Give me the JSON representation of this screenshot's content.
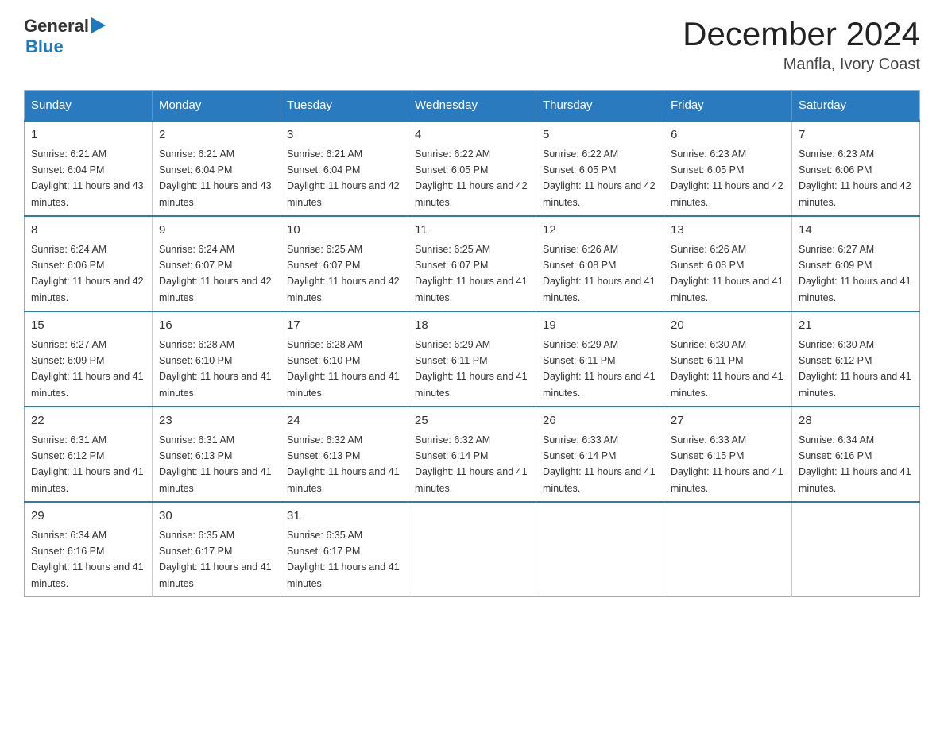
{
  "header": {
    "logo": {
      "general": "General",
      "blue": "Blue"
    },
    "title": "December 2024",
    "location": "Manfla, Ivory Coast"
  },
  "calendar": {
    "days_of_week": [
      "Sunday",
      "Monday",
      "Tuesday",
      "Wednesday",
      "Thursday",
      "Friday",
      "Saturday"
    ],
    "weeks": [
      [
        {
          "day": "1",
          "sunrise": "6:21 AM",
          "sunset": "6:04 PM",
          "daylight": "11 hours and 43 minutes."
        },
        {
          "day": "2",
          "sunrise": "6:21 AM",
          "sunset": "6:04 PM",
          "daylight": "11 hours and 43 minutes."
        },
        {
          "day": "3",
          "sunrise": "6:21 AM",
          "sunset": "6:04 PM",
          "daylight": "11 hours and 42 minutes."
        },
        {
          "day": "4",
          "sunrise": "6:22 AM",
          "sunset": "6:05 PM",
          "daylight": "11 hours and 42 minutes."
        },
        {
          "day": "5",
          "sunrise": "6:22 AM",
          "sunset": "6:05 PM",
          "daylight": "11 hours and 42 minutes."
        },
        {
          "day": "6",
          "sunrise": "6:23 AM",
          "sunset": "6:05 PM",
          "daylight": "11 hours and 42 minutes."
        },
        {
          "day": "7",
          "sunrise": "6:23 AM",
          "sunset": "6:06 PM",
          "daylight": "11 hours and 42 minutes."
        }
      ],
      [
        {
          "day": "8",
          "sunrise": "6:24 AM",
          "sunset": "6:06 PM",
          "daylight": "11 hours and 42 minutes."
        },
        {
          "day": "9",
          "sunrise": "6:24 AM",
          "sunset": "6:07 PM",
          "daylight": "11 hours and 42 minutes."
        },
        {
          "day": "10",
          "sunrise": "6:25 AM",
          "sunset": "6:07 PM",
          "daylight": "11 hours and 42 minutes."
        },
        {
          "day": "11",
          "sunrise": "6:25 AM",
          "sunset": "6:07 PM",
          "daylight": "11 hours and 41 minutes."
        },
        {
          "day": "12",
          "sunrise": "6:26 AM",
          "sunset": "6:08 PM",
          "daylight": "11 hours and 41 minutes."
        },
        {
          "day": "13",
          "sunrise": "6:26 AM",
          "sunset": "6:08 PM",
          "daylight": "11 hours and 41 minutes."
        },
        {
          "day": "14",
          "sunrise": "6:27 AM",
          "sunset": "6:09 PM",
          "daylight": "11 hours and 41 minutes."
        }
      ],
      [
        {
          "day": "15",
          "sunrise": "6:27 AM",
          "sunset": "6:09 PM",
          "daylight": "11 hours and 41 minutes."
        },
        {
          "day": "16",
          "sunrise": "6:28 AM",
          "sunset": "6:10 PM",
          "daylight": "11 hours and 41 minutes."
        },
        {
          "day": "17",
          "sunrise": "6:28 AM",
          "sunset": "6:10 PM",
          "daylight": "11 hours and 41 minutes."
        },
        {
          "day": "18",
          "sunrise": "6:29 AM",
          "sunset": "6:11 PM",
          "daylight": "11 hours and 41 minutes."
        },
        {
          "day": "19",
          "sunrise": "6:29 AM",
          "sunset": "6:11 PM",
          "daylight": "11 hours and 41 minutes."
        },
        {
          "day": "20",
          "sunrise": "6:30 AM",
          "sunset": "6:11 PM",
          "daylight": "11 hours and 41 minutes."
        },
        {
          "day": "21",
          "sunrise": "6:30 AM",
          "sunset": "6:12 PM",
          "daylight": "11 hours and 41 minutes."
        }
      ],
      [
        {
          "day": "22",
          "sunrise": "6:31 AM",
          "sunset": "6:12 PM",
          "daylight": "11 hours and 41 minutes."
        },
        {
          "day": "23",
          "sunrise": "6:31 AM",
          "sunset": "6:13 PM",
          "daylight": "11 hours and 41 minutes."
        },
        {
          "day": "24",
          "sunrise": "6:32 AM",
          "sunset": "6:13 PM",
          "daylight": "11 hours and 41 minutes."
        },
        {
          "day": "25",
          "sunrise": "6:32 AM",
          "sunset": "6:14 PM",
          "daylight": "11 hours and 41 minutes."
        },
        {
          "day": "26",
          "sunrise": "6:33 AM",
          "sunset": "6:14 PM",
          "daylight": "11 hours and 41 minutes."
        },
        {
          "day": "27",
          "sunrise": "6:33 AM",
          "sunset": "6:15 PM",
          "daylight": "11 hours and 41 minutes."
        },
        {
          "day": "28",
          "sunrise": "6:34 AM",
          "sunset": "6:16 PM",
          "daylight": "11 hours and 41 minutes."
        }
      ],
      [
        {
          "day": "29",
          "sunrise": "6:34 AM",
          "sunset": "6:16 PM",
          "daylight": "11 hours and 41 minutes."
        },
        {
          "day": "30",
          "sunrise": "6:35 AM",
          "sunset": "6:17 PM",
          "daylight": "11 hours and 41 minutes."
        },
        {
          "day": "31",
          "sunrise": "6:35 AM",
          "sunset": "6:17 PM",
          "daylight": "11 hours and 41 minutes."
        },
        null,
        null,
        null,
        null
      ]
    ],
    "labels": {
      "sunrise": "Sunrise:",
      "sunset": "Sunset:",
      "daylight": "Daylight:"
    }
  }
}
